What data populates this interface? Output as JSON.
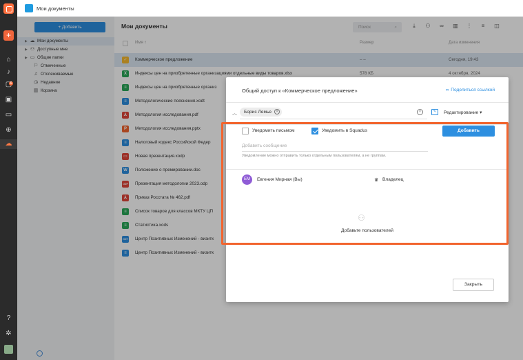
{
  "app": {
    "title": "Мои документы"
  },
  "rail": {
    "badge": "6"
  },
  "sidebar": {
    "add_label": "+ Добавить",
    "items": [
      {
        "label": "Мои документы",
        "icon": "cloud-icon"
      },
      {
        "label": "Доступные мне",
        "icon": "users-icon"
      },
      {
        "label": "Общие папки",
        "icon": "folder-icon"
      },
      {
        "label": "Отмеченные",
        "icon": "flag-icon"
      },
      {
        "label": "Отслеживаемые",
        "icon": "bell-icon"
      },
      {
        "label": "Недавние",
        "icon": "clock-icon"
      },
      {
        "label": "Корзина",
        "icon": "trash-icon"
      }
    ]
  },
  "main": {
    "title": "Мои документы",
    "search_placeholder": "Поиск",
    "columns": {
      "name": "Имя",
      "size": "Размер",
      "date": "Дата изменения"
    },
    "rows": [
      {
        "name": "Коммерческое предложение",
        "size": "– –",
        "date": "Сегодня, 19:43",
        "type": "folder",
        "color": "#f5b82e",
        "glyph": "✓"
      },
      {
        "name": "Индексы цен на приобретенные организациями отдельные виды товаров.xlsx",
        "size": "578 КБ",
        "date": "4 октября, 2024",
        "type": "xlsx",
        "color": "#2aa85a",
        "glyph": "X"
      },
      {
        "name": "Индексы цен на приобретенные организ",
        "size": "",
        "date": "",
        "type": "ods",
        "color": "#2aa85a",
        "glyph": "≡"
      },
      {
        "name": "Методологические пояснения.xodt",
        "size": "",
        "date": "",
        "type": "odt",
        "color": "#2d8fe0",
        "glyph": "≡"
      },
      {
        "name": "Методология исследования.pdf",
        "size": "",
        "date": "",
        "type": "pdf",
        "color": "#e0463a",
        "glyph": "⅄"
      },
      {
        "name": "Методология исследования.pptx",
        "size": "",
        "date": "",
        "type": "pptx",
        "color": "#f2652f",
        "glyph": "P"
      },
      {
        "name": "Налоговый кодекс Российской Федер",
        "size": "",
        "date": "",
        "type": "doc",
        "color": "#2d8fe0",
        "glyph": "≡"
      },
      {
        "name": "Новая презентация.xodp",
        "size": "",
        "date": "",
        "type": "odp",
        "color": "#e0463a",
        "glyph": "▭"
      },
      {
        "name": "Положение о премировании.doc",
        "size": "",
        "date": "",
        "type": "doc",
        "color": "#2d8fe0",
        "glyph": "W"
      },
      {
        "name": "Презентация методологии 2023.odp",
        "size": "",
        "date": "",
        "type": "odp",
        "color": "#e0463a",
        "glyph": "ODP"
      },
      {
        "name": "Приказ Росстата № 462.pdf",
        "size": "",
        "date": "",
        "type": "pdf",
        "color": "#e0463a",
        "glyph": "⅄"
      },
      {
        "name": "Список товаров для классов МКТУ ЦП",
        "size": "",
        "date": "",
        "type": "ods",
        "color": "#2aa85a",
        "glyph": "≡"
      },
      {
        "name": "Статистика.xods",
        "size": "",
        "date": "",
        "type": "ods",
        "color": "#2aa85a",
        "glyph": "≡"
      },
      {
        "name": "Центр Позитивных Изменений - визитк",
        "size": "",
        "date": "",
        "type": "odt",
        "color": "#2d8fe0",
        "glyph": "ODT"
      },
      {
        "name": "Центр Позитивных Изменений - визитк",
        "size": "",
        "date": "",
        "type": "odt",
        "color": "#2d8fe0",
        "glyph": "≡"
      }
    ]
  },
  "dialog": {
    "title": "Общий доступ к «Коммерческое предложение»",
    "share_link": "Поделиться ссылкой",
    "chip": "Борис Лемье",
    "permission": "Редактирование",
    "notify_email": "Уведомить письмом",
    "notify_squadus": "Уведомить в Squadus",
    "add_button": "Добавить",
    "message_placeholder": "Добавить сообщение",
    "hint": "Уведомление можно отправить только отдельным пользователям, а не группам.",
    "user": {
      "initials": "ЕМ",
      "name": "Евгения Мирная (Вы)",
      "role": "Владелец",
      "avatar_color": "#8f5cd6"
    },
    "empty_label": "Добавьте пользователей",
    "close_button": "Закрыть"
  },
  "colors": {
    "accent": "#2d8fe0",
    "brand": "#f2652f",
    "selected_row": "#dbe7f3"
  }
}
